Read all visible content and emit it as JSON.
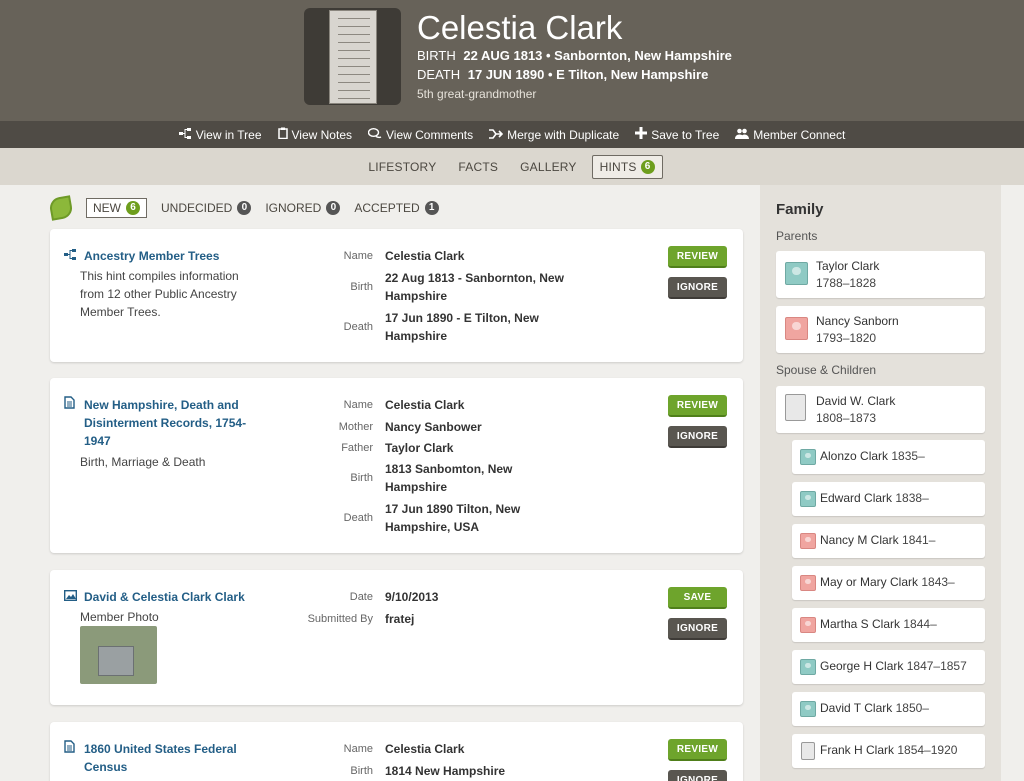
{
  "header": {
    "name": "Celestia Clark",
    "birth_label": "BIRTH",
    "birth_value": "22 AUG 1813 • Sanbornton, New Hampshire",
    "death_label": "DEATH",
    "death_value": "17 JUN 1890 • E Tilton, New Hampshire",
    "relationship": "5th great-grandmother"
  },
  "toolbar": {
    "actions": [
      {
        "label": "View in Tree",
        "icon": "tree-icon"
      },
      {
        "label": "View Notes",
        "icon": "notes-icon"
      },
      {
        "label": "View Comments",
        "icon": "comments-icon"
      },
      {
        "label": "Merge with Duplicate",
        "icon": "merge-icon"
      },
      {
        "label": "Save to Tree",
        "icon": "plus-icon"
      },
      {
        "label": "Member Connect",
        "icon": "people-icon"
      }
    ]
  },
  "tabs": {
    "items": [
      "LIFESTORY",
      "FACTS",
      "GALLERY",
      "HINTS"
    ],
    "hints_count": "6",
    "active": "HINTS"
  },
  "filters": {
    "new_label": "NEW",
    "new_count": "6",
    "undecided_label": "UNDECIDED",
    "undecided_count": "0",
    "ignored_label": "IGNORED",
    "ignored_count": "0",
    "accepted_label": "ACCEPTED",
    "accepted_count": "1"
  },
  "hints": [
    {
      "title": "Ancestry Member Trees",
      "icon": "tree-icon",
      "description": [
        "This hint compiles information",
        "from 12 other Public Ancestry",
        "Member Trees."
      ],
      "fields": [
        {
          "label": "Name",
          "value": [
            "Celestia Clark"
          ]
        },
        {
          "label": "Birth",
          "value": [
            "22 Aug 1813 - Sanbornton, New",
            "Hampshire"
          ]
        },
        {
          "label": "Death",
          "value": [
            "17 Jun 1890 - E Tilton, New",
            "Hampshire"
          ]
        }
      ],
      "primary": "REVIEW",
      "secondary": "IGNORE"
    },
    {
      "title": [
        "New Hampshire, Death and",
        "Disinterment Records, 1754-",
        "1947"
      ],
      "icon": "document-icon",
      "description": [
        "Birth, Marriage & Death"
      ],
      "fields": [
        {
          "label": "Name",
          "value": [
            "Celestia Clark"
          ]
        },
        {
          "label": "Mother",
          "value": [
            "Nancy Sanbower"
          ]
        },
        {
          "label": "Father",
          "value": [
            "Taylor Clark"
          ]
        },
        {
          "label": "Birth",
          "value": [
            "1813 Sanbomton, New",
            "Hampshire"
          ]
        },
        {
          "label": "Death",
          "value": [
            "17 Jun 1890 Tilton, New",
            "Hampshire, USA"
          ]
        }
      ],
      "primary": "REVIEW",
      "secondary": "IGNORE"
    },
    {
      "title": "David & Celestia Clark Clark",
      "icon": "photo-icon",
      "description": [
        "Member Photo"
      ],
      "fields": [
        {
          "label": "Date",
          "value": [
            "9/10/2013"
          ]
        },
        {
          "label": "Submitted By",
          "value": [
            "fratej"
          ]
        }
      ],
      "primary": "SAVE",
      "secondary": "IGNORE"
    },
    {
      "title": [
        "1860 United States Federal",
        "Census"
      ],
      "icon": "document-icon",
      "fields": [
        {
          "label": "Name",
          "value": [
            "Celestia Clark"
          ]
        },
        {
          "label": "Birth",
          "value": [
            "1814 New Hampshire"
          ]
        }
      ],
      "primary": "REVIEW",
      "secondary": "IGNORE"
    }
  ],
  "family": {
    "heading": "Family",
    "parents_label": "Parents",
    "parents": [
      {
        "name": "Taylor Clark",
        "dates": "1788–1828",
        "gender": "male"
      },
      {
        "name": "Nancy Sanborn",
        "dates": "1793–1820",
        "gender": "female"
      }
    ],
    "spouse_label": "Spouse & Children",
    "spouse": {
      "name": "David W. Clark",
      "dates": "1808–1873",
      "gender": "unknown"
    },
    "children": [
      {
        "name": "Alonzo Clark",
        "dates": "1835–",
        "gender": "male"
      },
      {
        "name": "Edward Clark",
        "dates": "1838–",
        "gender": "male"
      },
      {
        "name": "Nancy M Clark",
        "dates": "1841–",
        "gender": "female"
      },
      {
        "name": "May or Mary Clark",
        "dates": "1843–",
        "gender": "female"
      },
      {
        "name": "Martha S Clark",
        "dates": "1844–",
        "gender": "female"
      },
      {
        "name": "George H Clark",
        "dates": "1847–1857",
        "gender": "male"
      },
      {
        "name": "David T Clark",
        "dates": "1850–",
        "gender": "male"
      },
      {
        "name": "Frank H Clark",
        "dates": "1854–1920",
        "gender": "unknown"
      }
    ]
  }
}
